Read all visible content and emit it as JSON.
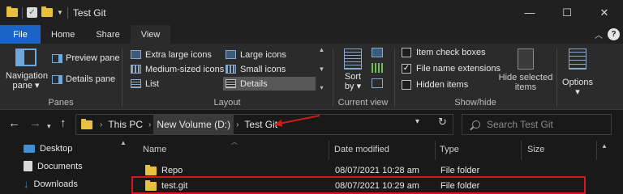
{
  "window": {
    "title": "Test Git",
    "controls": {
      "minimize": "—",
      "maximize": "☐",
      "close": "✕"
    }
  },
  "tabs": [
    "File",
    "Home",
    "Share",
    "View"
  ],
  "ribbon": {
    "panes": {
      "navigation_pane": "Navigation pane",
      "preview_pane": "Preview pane",
      "details_pane": "Details pane",
      "label": "Panes"
    },
    "layout": {
      "items": [
        "Extra large icons",
        "Large icons",
        "Medium-sized icons",
        "Small icons",
        "List",
        "Details"
      ],
      "selected": "Details",
      "label": "Layout"
    },
    "current_view": {
      "sort_by": "Sort by",
      "label": "Current view"
    },
    "show_hide": {
      "item_check_boxes": "Item check boxes",
      "file_name_extensions": "File name extensions",
      "hidden_items": "Hidden items",
      "checked": {
        "item_check_boxes": false,
        "file_name_extensions": true,
        "hidden_items": false
      },
      "hide_selected": "Hide selected items",
      "label": "Show/hide"
    },
    "options": "Options"
  },
  "address": {
    "crumbs": [
      "This PC",
      "New Volume (D:)",
      "Test Git"
    ],
    "search_placeholder": "Search Test Git"
  },
  "nav_pane": [
    "Desktop",
    "Documents",
    "Downloads"
  ],
  "columns": [
    "Name",
    "Date modified",
    "Type",
    "Size"
  ],
  "files": [
    {
      "name": "Repo",
      "date": "08/07/2021 10:28 am",
      "type": "File folder",
      "size": ""
    },
    {
      "name": "test.git",
      "date": "08/07/2021 10:29 am",
      "type": "File folder",
      "size": ""
    }
  ],
  "colors": {
    "accent": "#1a64c6",
    "folder": "#e9bf3f",
    "highlight": "#d11a1a"
  }
}
